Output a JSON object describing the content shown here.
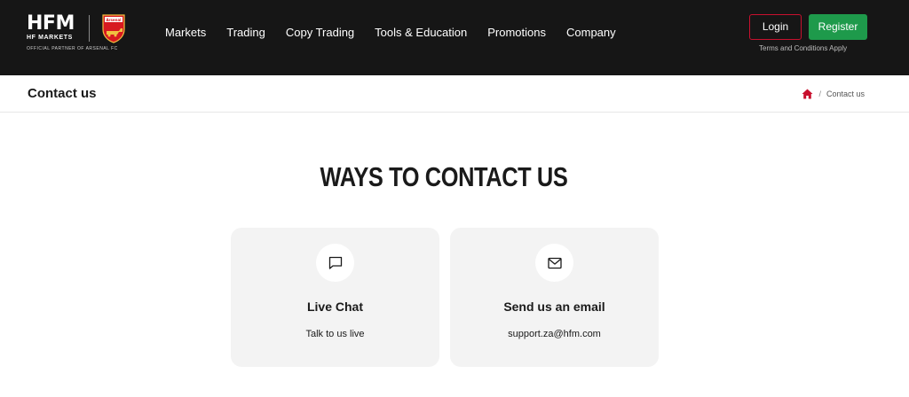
{
  "brand": {
    "logo_text": "HFM",
    "logo_subtext": "HF MARKETS",
    "partner_text": "OFFICIAL PARTNER OF ARSENAL FC",
    "crest_icon": "arsenal-crest-icon"
  },
  "nav": {
    "items": [
      {
        "label": "Markets"
      },
      {
        "label": "Trading"
      },
      {
        "label": "Copy Trading"
      },
      {
        "label": "Tools & Education"
      },
      {
        "label": "Promotions"
      },
      {
        "label": "Company"
      }
    ]
  },
  "auth": {
    "login_label": "Login",
    "register_label": "Register",
    "terms_text": "Terms and Conditions Apply"
  },
  "page_header": {
    "title": "Contact us",
    "breadcrumb": {
      "home_icon": "home-icon",
      "separator": "/",
      "current": "Contact us"
    }
  },
  "main": {
    "heading": "WAYS TO CONTACT US",
    "cards": [
      {
        "icon": "chat-bubble-icon",
        "title": "Live Chat",
        "subtitle": "Talk to us live"
      },
      {
        "icon": "envelope-icon",
        "title": "Send us an email",
        "subtitle": "support.za@hfm.com"
      }
    ]
  },
  "colors": {
    "topbar_bg": "#161616",
    "login_border": "#c8102e",
    "register_bg": "#1e9a4b",
    "home_icon": "#c8102e",
    "card_bg": "#f3f3f3"
  }
}
